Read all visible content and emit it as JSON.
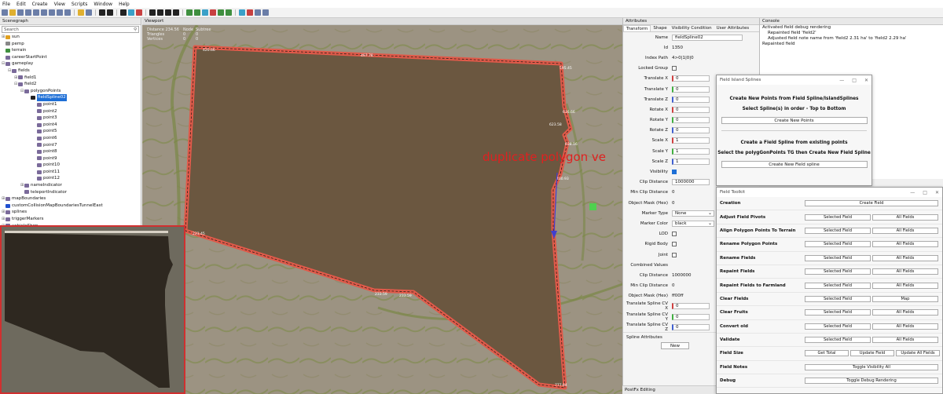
{
  "menu": [
    "File",
    "Edit",
    "Create",
    "View",
    "Scripts",
    "Window",
    "Help"
  ],
  "scenegraph": {
    "title": "Scenegraph",
    "search_placeholder": "Search",
    "items": [
      {
        "label": "sun",
        "depth": 0,
        "icon": "sun-icon",
        "exp": "⊞"
      },
      {
        "label": "pemp",
        "depth": 0,
        "icon": "object-icon",
        "exp": ""
      },
      {
        "label": "terrain",
        "depth": 0,
        "icon": "terrain-icon",
        "exp": ""
      },
      {
        "label": "careerStartPoint",
        "depth": 0,
        "icon": "transform-icon",
        "exp": ""
      },
      {
        "label": "gameplay",
        "depth": 0,
        "icon": "transform-icon",
        "exp": "⊟"
      },
      {
        "label": "fields",
        "depth": 1,
        "icon": "transform-icon",
        "exp": "⊟"
      },
      {
        "label": "field1",
        "depth": 2,
        "icon": "transform-icon",
        "exp": "⊞"
      },
      {
        "label": "field2",
        "depth": 2,
        "icon": "transform-icon",
        "exp": "⊟"
      },
      {
        "label": "polygonPoints",
        "depth": 3,
        "icon": "transform-icon",
        "exp": "⊟"
      },
      {
        "label": "fieldSpline02",
        "depth": 4,
        "icon": "spline-icon",
        "exp": "",
        "selected": true
      },
      {
        "label": "point1",
        "depth": 5,
        "icon": "transform-icon",
        "exp": ""
      },
      {
        "label": "point2",
        "depth": 5,
        "icon": "transform-icon",
        "exp": ""
      },
      {
        "label": "point3",
        "depth": 5,
        "icon": "transform-icon",
        "exp": ""
      },
      {
        "label": "point4",
        "depth": 5,
        "icon": "transform-icon",
        "exp": ""
      },
      {
        "label": "point5",
        "depth": 5,
        "icon": "transform-icon",
        "exp": ""
      },
      {
        "label": "point6",
        "depth": 5,
        "icon": "transform-icon",
        "exp": ""
      },
      {
        "label": "point7",
        "depth": 5,
        "icon": "transform-icon",
        "exp": ""
      },
      {
        "label": "point8",
        "depth": 5,
        "icon": "transform-icon",
        "exp": ""
      },
      {
        "label": "point9",
        "depth": 5,
        "icon": "transform-icon",
        "exp": ""
      },
      {
        "label": "point10",
        "depth": 5,
        "icon": "transform-icon",
        "exp": ""
      },
      {
        "label": "point11",
        "depth": 5,
        "icon": "transform-icon",
        "exp": ""
      },
      {
        "label": "point12",
        "depth": 5,
        "icon": "transform-icon",
        "exp": ""
      },
      {
        "label": "nameIndicator",
        "depth": 3,
        "icon": "transform-icon",
        "exp": "⊞"
      },
      {
        "label": "teleportIndicator",
        "depth": 3,
        "icon": "transform-icon",
        "exp": ""
      },
      {
        "label": "mapBoundaries",
        "depth": 0,
        "icon": "transform-icon",
        "exp": "⊞"
      },
      {
        "label": "customCollisionMapBoundariesTunnelEast",
        "depth": 0,
        "icon": "cube-icon",
        "exp": ""
      },
      {
        "label": "splines",
        "depth": 0,
        "icon": "transform-icon",
        "exp": "⊞"
      },
      {
        "label": "triggerMarkers",
        "depth": 0,
        "icon": "transform-icon",
        "exp": "⊞"
      },
      {
        "label": "vehicleShop",
        "depth": 0,
        "icon": "transform-icon",
        "exp": "⊞"
      }
    ]
  },
  "viewport": {
    "title": "Viewport",
    "stats": [
      [
        "Distance 234.56",
        "Node",
        "Subtree"
      ],
      [
        "Triangles",
        "0",
        "0"
      ],
      [
        "Vertices",
        "0",
        "0"
      ]
    ],
    "overlay_text": "duplicate polygon ve",
    "edge_labels": [
      "420.66",
      "497.78",
      "595.45",
      "616.66",
      "623.58",
      "638.16",
      "430.93",
      "233.45",
      "233.59",
      "233.59",
      "777.64"
    ]
  },
  "attributes": {
    "title": "Attributes",
    "tabs": [
      "Transform",
      "Shape",
      "Visibility Condition",
      "User Attributes"
    ],
    "rows": [
      {
        "k": "Name",
        "type": "box-wide",
        "v": "fieldSpline02"
      },
      {
        "k": "Id",
        "type": "text",
        "v": "1350"
      },
      {
        "k": "Index Path",
        "type": "text",
        "v": "4>0|1|0|0"
      },
      {
        "k": "Locked Group",
        "type": "check",
        "v": ""
      },
      {
        "k": "Translate X",
        "type": "box",
        "v": "0",
        "axis": "x"
      },
      {
        "k": "Translate Y",
        "type": "box",
        "v": "0",
        "axis": "y"
      },
      {
        "k": "Translate Z",
        "type": "box",
        "v": "0",
        "axis": "z"
      },
      {
        "k": "Rotate X",
        "type": "box",
        "v": "0",
        "axis": "x"
      },
      {
        "k": "Rotate Y",
        "type": "box",
        "v": "0",
        "axis": "y"
      },
      {
        "k": "Rotate Z",
        "type": "box",
        "v": "0",
        "axis": "z"
      },
      {
        "k": "Scale X",
        "type": "box",
        "v": "1",
        "axis": "x"
      },
      {
        "k": "Scale Y",
        "type": "box",
        "v": "1",
        "axis": "y"
      },
      {
        "k": "Scale Z",
        "type": "box",
        "v": "1",
        "axis": "z"
      },
      {
        "k": "Visibility",
        "type": "check-on",
        "v": ""
      },
      {
        "k": "Clip Distance",
        "type": "box",
        "v": "1000000"
      },
      {
        "k": "Min Clip Distance",
        "type": "text",
        "v": "0"
      },
      {
        "k": "Object Mask (Hex)",
        "type": "text",
        "v": "0"
      },
      {
        "k": "Marker Type",
        "type": "select",
        "v": "None"
      },
      {
        "k": "Marker Color",
        "type": "select",
        "v": "black"
      },
      {
        "k": "LOD",
        "type": "check",
        "v": ""
      },
      {
        "k": "Rigid Body",
        "type": "check",
        "v": ""
      },
      {
        "k": "Joint",
        "type": "check",
        "v": ""
      },
      {
        "k": "Combined Values",
        "type": "text",
        "v": ""
      },
      {
        "k": "Clip Distance",
        "type": "text",
        "v": "1000000"
      },
      {
        "k": "Min Clip Distance",
        "type": "text",
        "v": "0"
      },
      {
        "k": "Object Mask (Hex)",
        "type": "text",
        "v": "ff00ff"
      },
      {
        "k": "Translate Spline CV X",
        "type": "box",
        "v": "0",
        "axis": "x"
      },
      {
        "k": "Translate Spline CV Y",
        "type": "box",
        "v": "0",
        "axis": "y"
      },
      {
        "k": "Translate Spline CV Z",
        "type": "box",
        "v": "0",
        "axis": "z"
      }
    ],
    "spline_attributes": "Spline Attributes",
    "new_button": "New"
  },
  "console": {
    "title": "Console",
    "lines": [
      "Activated field debug rendering",
      "    Repainted field 'field2'",
      "    Adjusted field note name from 'field2 2.31 ha' to 'field2 2.29 ha'",
      "Repainted field"
    ]
  },
  "field_island_splines": {
    "title": "Field Island Splines",
    "heading1": "Create New Points from Field Spline/IslandSplines",
    "sub1": "Select Spline(s) in order - Top to Bottom",
    "button1": "Create New Points",
    "heading2": "Create a Field Spline from existing points",
    "sub2": "Select the polygGonPoints TG then Create New Field Spline",
    "button2": "Create New Field spline"
  },
  "field_toolkit": {
    "title": "Field Toolkit",
    "rows": [
      {
        "label": "Creation",
        "buttons": [
          "Create Field"
        ]
      },
      {
        "label": "Adjust Field Pivots",
        "buttons": [
          "Selected Field",
          "All Fields"
        ]
      },
      {
        "label": "Align Polygon Points To Terrain",
        "buttons": [
          "Selected Field",
          "All Fields"
        ]
      },
      {
        "label": "Rename Polygon Points",
        "buttons": [
          "Selected Field",
          "All Fields"
        ]
      },
      {
        "label": "Rename Fields",
        "buttons": [
          "Selected Field",
          "All Fields"
        ]
      },
      {
        "label": "Repaint Fields",
        "buttons": [
          "Selected Field",
          "All Fields"
        ]
      },
      {
        "label": "Repaint Fields to Farmland",
        "buttons": [
          "Selected Field",
          "All Fields"
        ]
      },
      {
        "label": "Clear Fields",
        "buttons": [
          "Selected Field",
          "Map"
        ]
      },
      {
        "label": "Clear Fruits",
        "buttons": [
          "Selected Field",
          "All Fields"
        ]
      },
      {
        "label": "Convert old",
        "buttons": [
          "Selected Field",
          "All Fields"
        ]
      },
      {
        "label": "Validate",
        "buttons": [
          "Selected Field",
          "All Fields"
        ]
      },
      {
        "label": "Field Size",
        "buttons": [
          "Get Total",
          "Update Field",
          "Update All Fields"
        ]
      },
      {
        "label": "Field Notes",
        "buttons": [
          "Toggle Visibility All"
        ]
      },
      {
        "label": "Debug",
        "buttons": [
          "Toggle Debug Rendering"
        ]
      }
    ]
  },
  "postfx": "PostFx Editing",
  "colors": {
    "field_fill": "#6b5740",
    "field_border": "#e05a4a",
    "selection": "#1e6fd6",
    "minimap_border": "#d03030",
    "overlay_text": "#e02020"
  }
}
